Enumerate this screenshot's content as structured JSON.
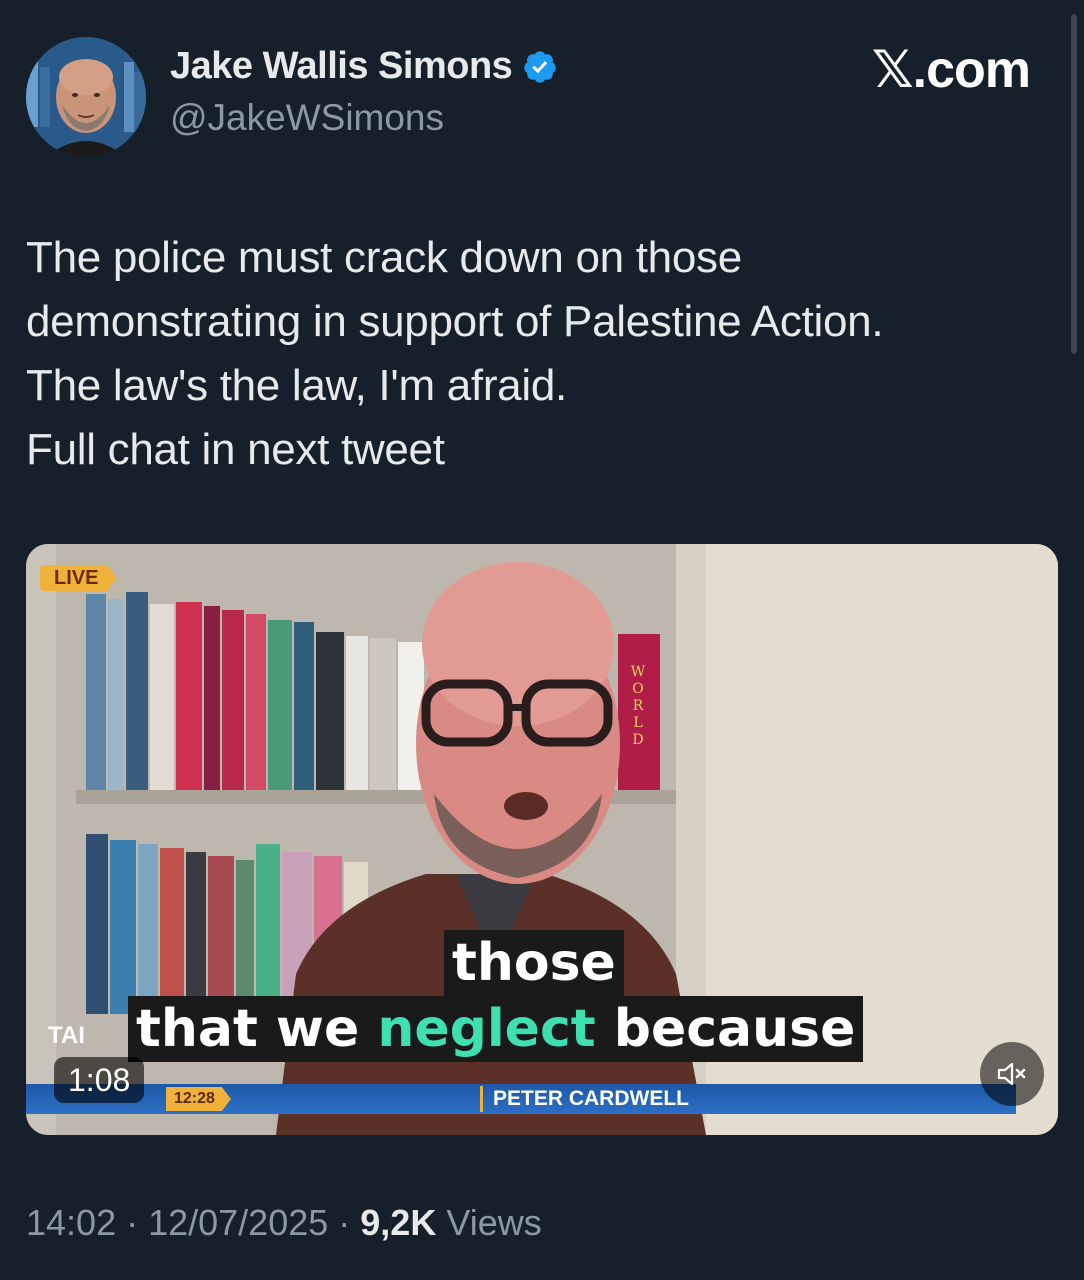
{
  "author": {
    "display_name": "Jake Wallis Simons",
    "handle": "@JakeWSimons",
    "verified": true
  },
  "site_tag": "𝕏.com",
  "tweet": {
    "lines": [
      "The police must crack down on those",
      "demonstrating in support of Palestine Action.",
      "The law's the law, I'm afraid.",
      "Full chat in next tweet"
    ]
  },
  "video": {
    "live_label": "LIVE",
    "caption_top": "those",
    "caption_bottom_prefix": "that we ",
    "caption_bottom_highlight": "neglect",
    "caption_bottom_suffix": " because",
    "channel_partial": "TAI",
    "ticker_time": "12:28",
    "ticker_name": "PETER CARDWELL",
    "duration": "1:08",
    "book_spine_text": "WORLD"
  },
  "meta": {
    "time": "14:02",
    "separator": " · ",
    "date": "12/07/2025",
    "views_count": "9,2K",
    "views_label": " Views"
  },
  "colors": {
    "background": "#15202b",
    "text_primary": "#e7e9ea",
    "text_secondary": "#8b98a5",
    "verified_blue": "#1d9bf0",
    "caption_highlight": "#3fe0b0",
    "live_badge": "#f0b13b"
  },
  "icons": {
    "verified": "verified-badge-icon",
    "mute": "speaker-muted-icon"
  }
}
